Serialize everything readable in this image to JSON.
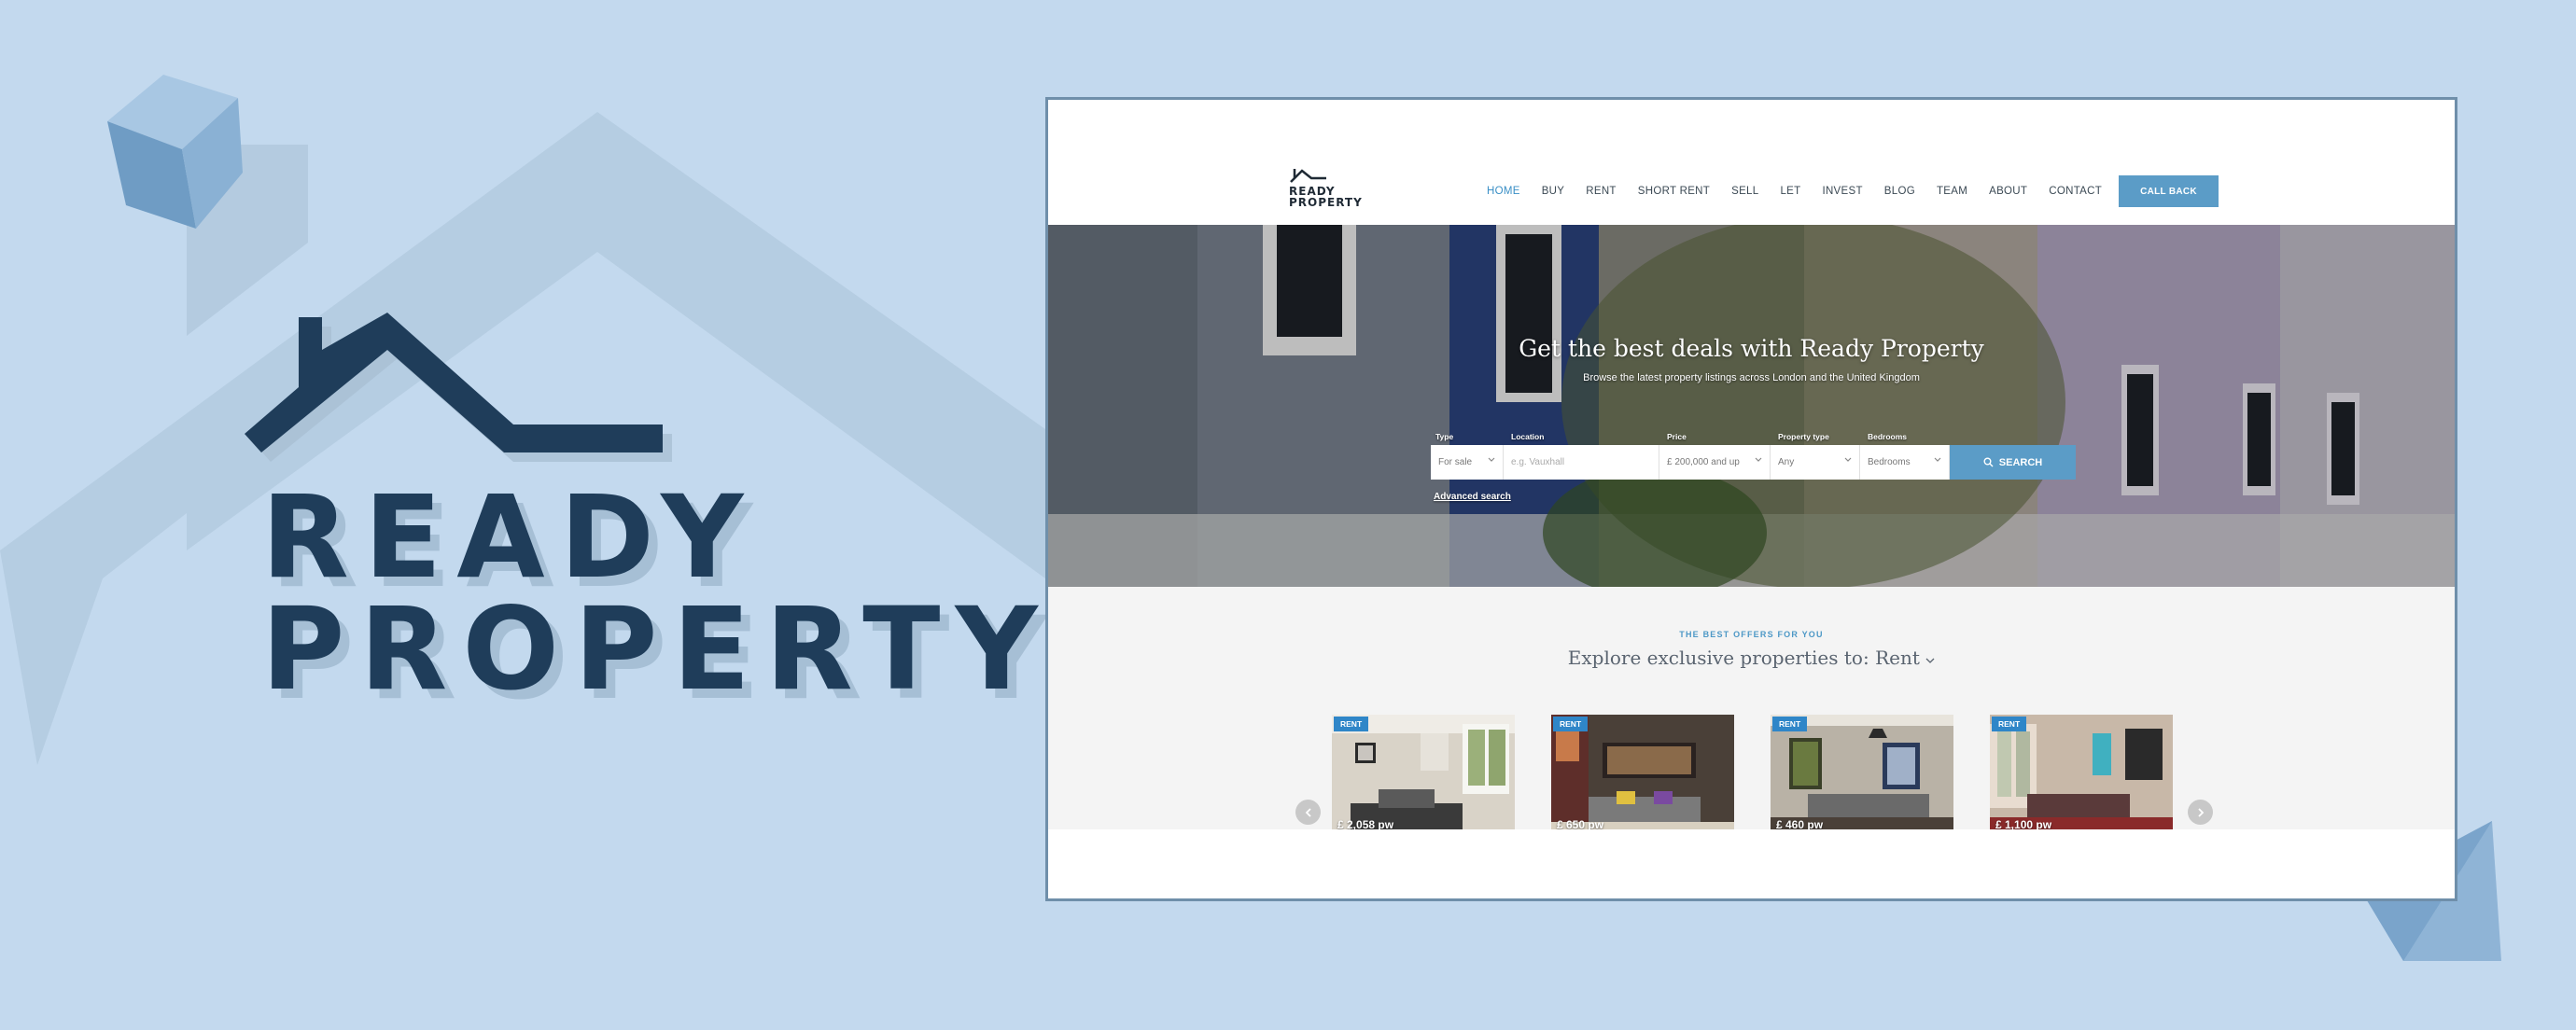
{
  "brand": {
    "line1": "READY",
    "line2": "PROPERTY"
  },
  "site_logo": {
    "line1": "READY",
    "line2": "PROPERTY"
  },
  "nav": {
    "items": [
      "HOME",
      "BUY",
      "RENT",
      "SHORT RENT",
      "SELL",
      "LET",
      "INVEST",
      "BLOG",
      "TEAM",
      "ABOUT",
      "CONTACT"
    ],
    "active": "HOME",
    "call_back": "CALL BACK"
  },
  "hero": {
    "title": "Get the best deals with Ready Property",
    "subtitle": "Browse the latest property listings across London and the United Kingdom"
  },
  "search": {
    "labels": {
      "type": "Type",
      "location": "Location",
      "price": "Price",
      "property_type": "Property type",
      "bedrooms": "Bedrooms"
    },
    "type_value": "For sale",
    "location_placeholder": "e.g. Vauxhall",
    "price_value": "£ 200,000 and up",
    "property_type_value": "Any",
    "bedrooms_value": "Bedrooms",
    "button": "SEARCH",
    "advanced": "Advanced search"
  },
  "offers": {
    "kicker": "THE BEST OFFERS FOR YOU",
    "title": "Explore exclusive properties to:",
    "selected": "Rent",
    "cards": [
      {
        "tag": "RENT",
        "price": "£   2,058 pw"
      },
      {
        "tag": "RENT",
        "price": "£   650 pw"
      },
      {
        "tag": "RENT",
        "price": "£   460 pw"
      },
      {
        "tag": "RENT",
        "price": "£   1,100 pw"
      }
    ]
  },
  "colors": {
    "background": "#c3d9ee",
    "brand_dark": "#1f3d5a",
    "accent": "#5b9cc7",
    "tag": "#2f86c8"
  }
}
